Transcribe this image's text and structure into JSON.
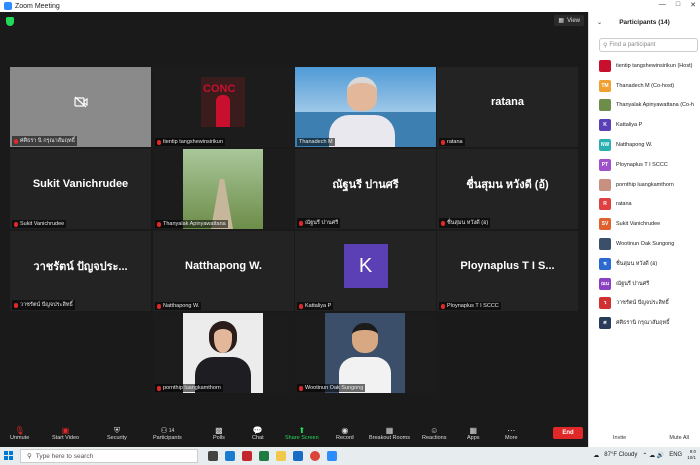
{
  "window": {
    "title": "Zoom Meeting"
  },
  "view_label": "View",
  "tiles": [
    {
      "name": "ศศิธรา นิ กรุณาสัมฤทธิ์",
      "display": "",
      "kind": "camera-off"
    },
    {
      "name": "tientip tangshewinsirikun",
      "display": "",
      "kind": "video",
      "bg": "#3a1c1c",
      "accent": "#c8102e",
      "logo_text": "CONC"
    },
    {
      "name": "Thanadech M",
      "display": "",
      "kind": "video",
      "bg": "#5fa6d8",
      "active": true
    },
    {
      "name": "ratana",
      "display": "ratana",
      "kind": "text"
    },
    {
      "name": "Sukit Vanichrudee",
      "display": "Sukit Vanichrudee",
      "kind": "text"
    },
    {
      "name": "Thanyalak Apinyawattana",
      "display": "",
      "kind": "video",
      "bg": "#6d8d4a"
    },
    {
      "name": "ณัฐนรี ปานศรี",
      "display": "ณัฐนรี ปานศรี",
      "kind": "text"
    },
    {
      "name": "ชื่นสุมน หวังดี (อ)",
      "display": "ชื่นสุมน หวังดี (อ้)",
      "kind": "text"
    },
    {
      "name": "วาชรัตน์ ปัญจประสิทธิ์",
      "display": "วาชรัตน์ ปัญจประ...",
      "kind": "text"
    },
    {
      "name": "Natthapong W.",
      "display": "Natthapong W.",
      "kind": "text"
    },
    {
      "name": "Kattaliya P",
      "display": "K",
      "kind": "avatar"
    },
    {
      "name": "Ploynaplus T I SCCC",
      "display": "Ploynaplus T I S...",
      "kind": "text"
    },
    {
      "name": "pornthip luangkamthorn",
      "display": "",
      "kind": "video",
      "bg": "#e9e9e9"
    },
    {
      "name": "Wootinun Oak Sungong",
      "display": "",
      "kind": "video",
      "bg": "#3b4f6a"
    }
  ],
  "toolbar": {
    "unmute": "Unmute",
    "start_video": "Start Video",
    "security": "Security",
    "participants": "Participants",
    "participants_count": "14",
    "polls": "Polls",
    "chat": "Chat",
    "share_screen": "Share Screen",
    "record": "Record",
    "breakout": "Breakout Rooms",
    "reactions": "Reactions",
    "apps": "Apps",
    "more": "More",
    "end": "End"
  },
  "panel": {
    "title": "Participants (14)",
    "search_placeholder": "Find a participant",
    "participants": [
      {
        "name": "tientip tangshewinsirikun (Host)",
        "initials": "",
        "color": "#c8102e"
      },
      {
        "name": "Thanadech M (Co-host)",
        "initials": "TM",
        "color": "#f0a030"
      },
      {
        "name": "Thanyalak Apinyawattana (Co-h",
        "initials": "",
        "color": "#6d8d4a"
      },
      {
        "name": "Kattaliya P",
        "initials": "K",
        "color": "#5a3fb5"
      },
      {
        "name": "Natthapong W.",
        "initials": "NW",
        "color": "#2ab0b0"
      },
      {
        "name": "Ploynaplus T I SCCC",
        "initials": "PT",
        "color": "#a050c8"
      },
      {
        "name": "pornthip luangkamthorn",
        "initials": "",
        "color": "#c89080"
      },
      {
        "name": "ratana",
        "initials": "R",
        "color": "#e04040"
      },
      {
        "name": "Sukit Vanichrudee",
        "initials": "SV",
        "color": "#e06030"
      },
      {
        "name": "Wootinun Oak Sungong",
        "initials": "",
        "color": "#3b4f6a"
      },
      {
        "name": "ชื่นสุมน หวังดี (อ)",
        "initials": "ช",
        "color": "#2a6ad0"
      },
      {
        "name": "ณัฐนรี ปานศรี",
        "initials": "ณน",
        "color": "#8a40c0"
      },
      {
        "name": "วาชรัตน์ ปัญจประสิทธิ์",
        "initials": "ว",
        "color": "#d03030"
      },
      {
        "name": "ศศิธรานิ กรุณาสัมฤทธิ์",
        "initials": "ศ",
        "color": "#2a3a5a"
      }
    ],
    "invite": "Invite",
    "mute_all": "Mute All"
  },
  "taskbar": {
    "search_placeholder": "Type here to search",
    "weather": "87°F  Cloudy",
    "lang": "ENG",
    "time": "9:0",
    "date": "10/1"
  }
}
